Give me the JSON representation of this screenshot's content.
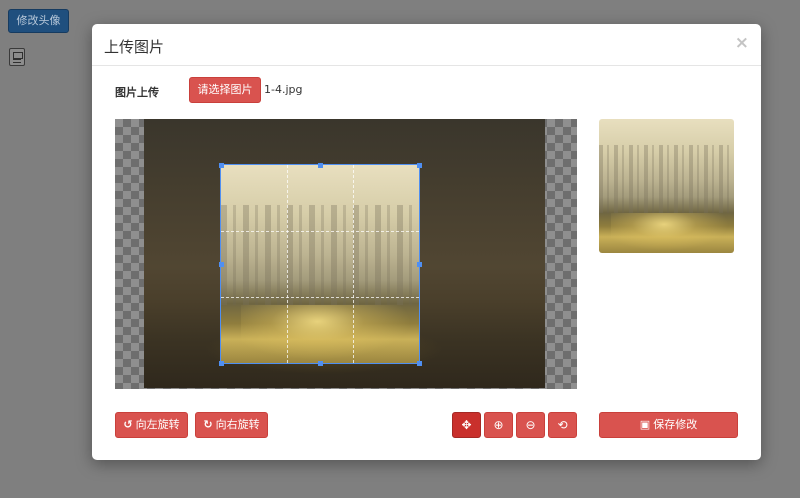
{
  "page": {
    "edit_avatar_button": "修改头像"
  },
  "modal": {
    "title": "上传图片",
    "close_symbol": "×",
    "upload": {
      "label": "图片上传",
      "choose_button": "请选择图片",
      "file_name": "1-4.jpg"
    },
    "actions": {
      "rotate_left": "向左旋转",
      "rotate_right": "向右旋转",
      "move_icon": "✥",
      "zoom_in_icon": "⊕",
      "zoom_out_icon": "⊖",
      "reset_icon": "⟲",
      "save": "保存修改"
    }
  },
  "colors": {
    "accent_red": "#d9534f",
    "crop_border": "#4f8ff2",
    "primary_button": "#1f4f7e"
  }
}
